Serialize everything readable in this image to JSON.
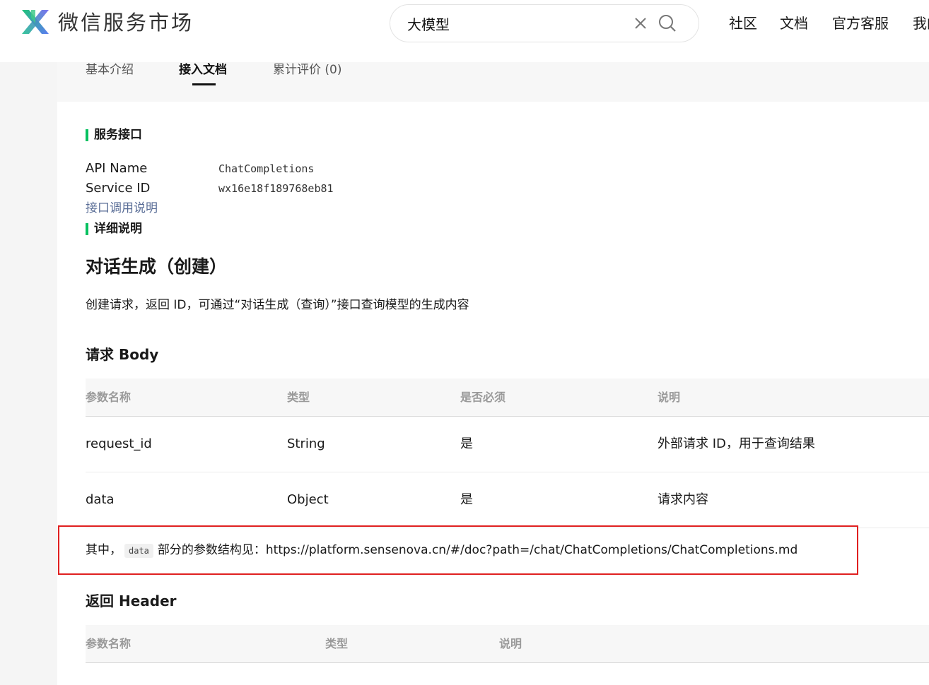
{
  "header": {
    "brand": "微信服务市场",
    "search": {
      "value": "大模型"
    },
    "nav": [
      {
        "label": "社区"
      },
      {
        "label": "文档"
      },
      {
        "label": "官方客服"
      },
      {
        "label": "我的"
      }
    ]
  },
  "tabs": [
    {
      "label": "基本介绍",
      "active": false
    },
    {
      "label": "接入文档",
      "active": true
    },
    {
      "label": "累计评价 (0)",
      "active": false
    }
  ],
  "service": {
    "section_title": "服务接口",
    "api_name_label": "API Name",
    "api_name_value": "ChatCompletions",
    "service_id_label": "Service ID",
    "service_id_value": "wx16e18f189768eb81",
    "doc_link": "接口调用说明"
  },
  "detail": {
    "section_title": "详细说明",
    "title": "对话生成（创建）",
    "description": "创建请求，返回 ID，可通过“对话生成（查询）”接口查询模型的生成内容"
  },
  "request_body": {
    "title": "请求 Body",
    "headers": [
      "参数名称",
      "类型",
      "是否必须",
      "说明"
    ],
    "rows": [
      [
        "request_id",
        "String",
        "是",
        "外部请求 ID，用于查询结果"
      ],
      [
        "data",
        "Object",
        "是",
        "请求内容"
      ]
    ],
    "note_prefix": "其中，",
    "note_code": "data",
    "note_middle": "部分的参数结构见：",
    "note_url": "https://platform.sensenova.cn/#/doc?path=/chat/ChatCompletions/ChatCompletions.md"
  },
  "response_header": {
    "title": "返回 Header",
    "headers": [
      "参数名称",
      "类型",
      "说明"
    ]
  },
  "colors": {
    "accent": "#07c160",
    "highlight_box": "#e02020",
    "link": "#576b95"
  }
}
